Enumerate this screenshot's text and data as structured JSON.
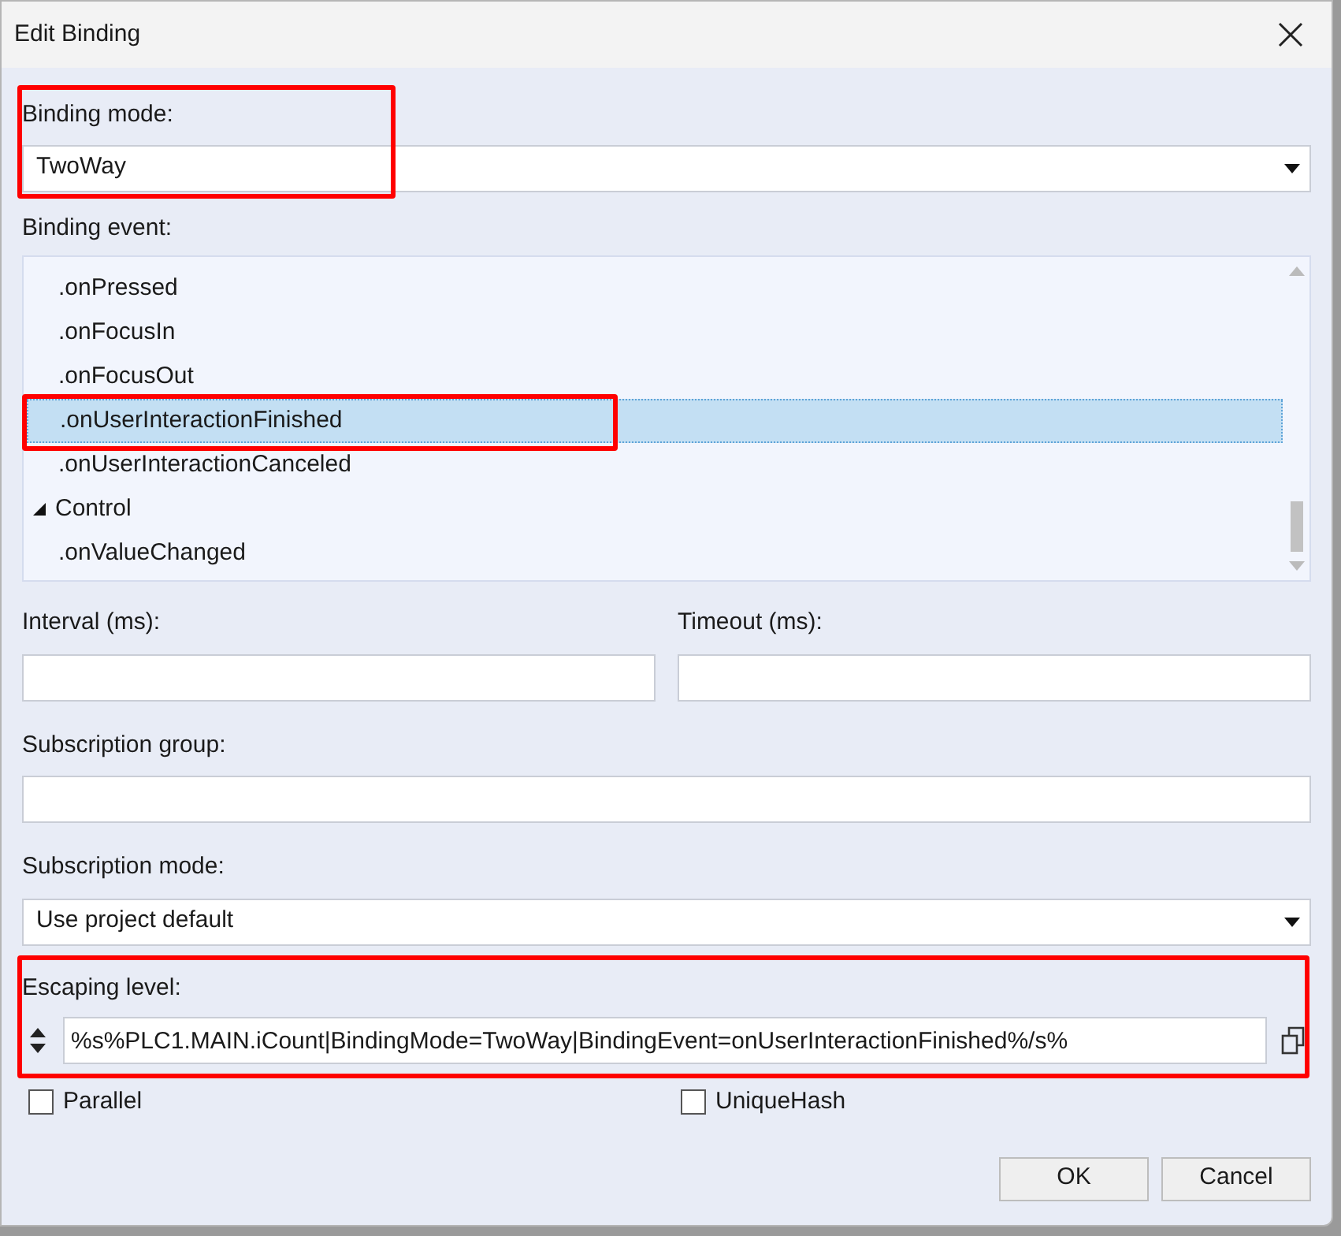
{
  "window": {
    "title": "Edit Binding"
  },
  "binding_mode": {
    "label": "Binding mode:",
    "value": "TwoWay"
  },
  "binding_event": {
    "label": "Binding event:",
    "items": [
      {
        "kind": "item",
        "label": ".onPressed",
        "selected": false
      },
      {
        "kind": "item",
        "label": ".onFocusIn",
        "selected": false
      },
      {
        "kind": "item",
        "label": ".onFocusOut",
        "selected": false
      },
      {
        "kind": "item",
        "label": ".onUserInteractionFinished",
        "selected": true
      },
      {
        "kind": "item",
        "label": ".onUserInteractionCanceled",
        "selected": false
      },
      {
        "kind": "group",
        "label": "Control",
        "expanded": true,
        "selected": false
      },
      {
        "kind": "item",
        "label": ".onValueChanged",
        "selected": false
      }
    ]
  },
  "interval": {
    "label": "Interval (ms):"
  },
  "timeout": {
    "label": "Timeout (ms):"
  },
  "subscription_group": {
    "label": "Subscription group:"
  },
  "subscription_mode": {
    "label": "Subscription mode:",
    "value": "Use project default"
  },
  "escaping_level": {
    "label": "Escaping level:",
    "value": "%s%PLC1.MAIN.iCount|BindingMode=TwoWay|BindingEvent=onUserInteractionFinished%/s%"
  },
  "checkboxes": [
    {
      "label": "Parallel",
      "checked": false
    },
    {
      "label": "UniqueHash",
      "checked": false
    }
  ],
  "buttons": [
    "OK",
    "Cancel"
  ]
}
